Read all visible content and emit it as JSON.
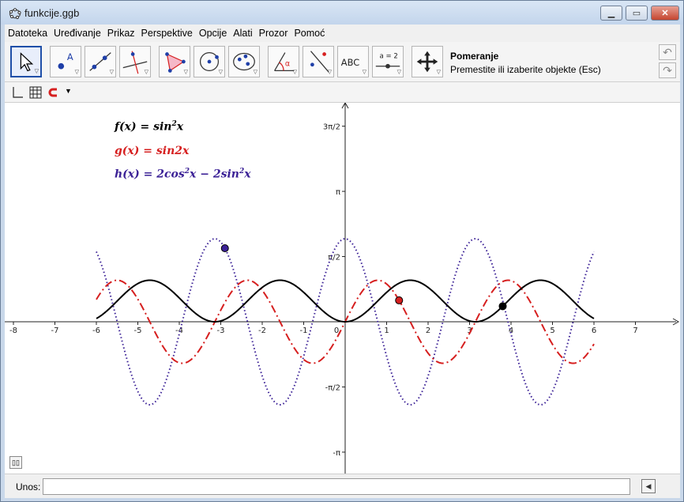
{
  "window": {
    "title": "funkcije.ggb"
  },
  "menu": [
    "Datoteka",
    "Uređivanje",
    "Prikaz",
    "Perspektive",
    "Opcije",
    "Alati",
    "Prozor",
    "Pomoć"
  ],
  "tools": [
    {
      "name": "move-tool",
      "icon": "arrow-pointer-icon"
    },
    {
      "name": "point-tool",
      "icon": "point-icon",
      "label": "A"
    },
    {
      "name": "line-tool",
      "icon": "line-icon"
    },
    {
      "name": "perpendicular-tool",
      "icon": "perpendicular-line-icon"
    },
    {
      "name": "polygon-tool",
      "icon": "polygon-icon"
    },
    {
      "name": "circle-tool",
      "icon": "circle-icon"
    },
    {
      "name": "conic-tool",
      "icon": "ellipse-icon"
    },
    {
      "name": "angle-tool",
      "icon": "angle-icon",
      "label": "α"
    },
    {
      "name": "reflect-tool",
      "icon": "reflect-icon"
    },
    {
      "name": "text-tool",
      "icon": "text-icon",
      "label": "ABC"
    },
    {
      "name": "slider-tool",
      "icon": "slider-icon",
      "label": "a = 2"
    },
    {
      "name": "move-view-tool",
      "icon": "move-arrows-icon"
    }
  ],
  "tool_help": {
    "title": "Pomeranje",
    "description": "Premestite ili izaberite objekte (Esc)"
  },
  "equations": {
    "f": {
      "lhs": "f(x) = sin",
      "exp": "2",
      "rhs": "x",
      "color": "#000000"
    },
    "g": {
      "lhs": "g(x) = sin2x",
      "color": "#d61f1f"
    },
    "h": {
      "lhs": "h(x) = 2cos",
      "exp1": "2",
      "mid": "x − 2sin",
      "exp2": "2",
      "rhs": "x",
      "color": "#3b2196"
    }
  },
  "axes": {
    "x_ticks": [
      "-8",
      "-7",
      "-6",
      "-5",
      "-4",
      "-3",
      "-2",
      "-1",
      "0",
      "1",
      "2",
      "3",
      "4",
      "5",
      "6",
      "7"
    ],
    "y_ticks": [
      "3π/2",
      "π",
      "π/2",
      "-π/2",
      "-π"
    ]
  },
  "points": [
    {
      "x": -2.9,
      "func": "h",
      "color": "#3b2196"
    },
    {
      "x": 1.3,
      "func": "g",
      "color": "#d61f1f"
    },
    {
      "x": 3.8,
      "func": "f",
      "color": "#000000"
    }
  ],
  "input": {
    "label": "Unos:",
    "value": ""
  }
}
